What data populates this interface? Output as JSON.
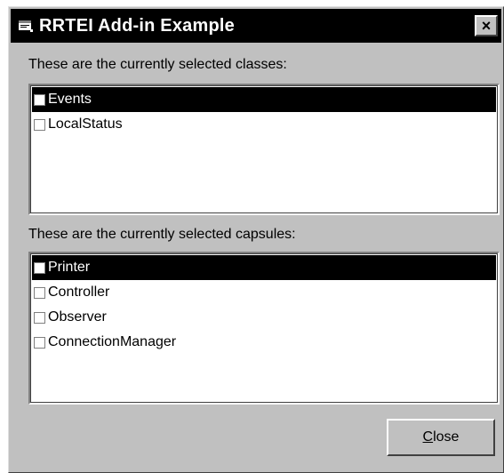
{
  "window": {
    "title": "RRTEI Add-in Example",
    "close_glyph": "×",
    "icon": "app-window-icon"
  },
  "classes": {
    "label": "These are the currently selected classes:",
    "items": [
      {
        "label": "Events",
        "selected": true,
        "checked": false
      },
      {
        "label": "LocalStatus",
        "selected": false,
        "checked": false
      }
    ]
  },
  "capsules": {
    "label": "These are the currently selected capsules:",
    "items": [
      {
        "label": "Printer",
        "selected": true,
        "checked": false
      },
      {
        "label": "Controller",
        "selected": false,
        "checked": false
      },
      {
        "label": "Observer",
        "selected": false,
        "checked": false
      },
      {
        "label": "ConnectionManager",
        "selected": false,
        "checked": false
      }
    ]
  },
  "buttons": {
    "close_mnemonic": "C",
    "close_rest": "lose"
  },
  "colors": {
    "face": "#c0c0c0",
    "titlebar": "#000000",
    "selection": "#000000"
  }
}
